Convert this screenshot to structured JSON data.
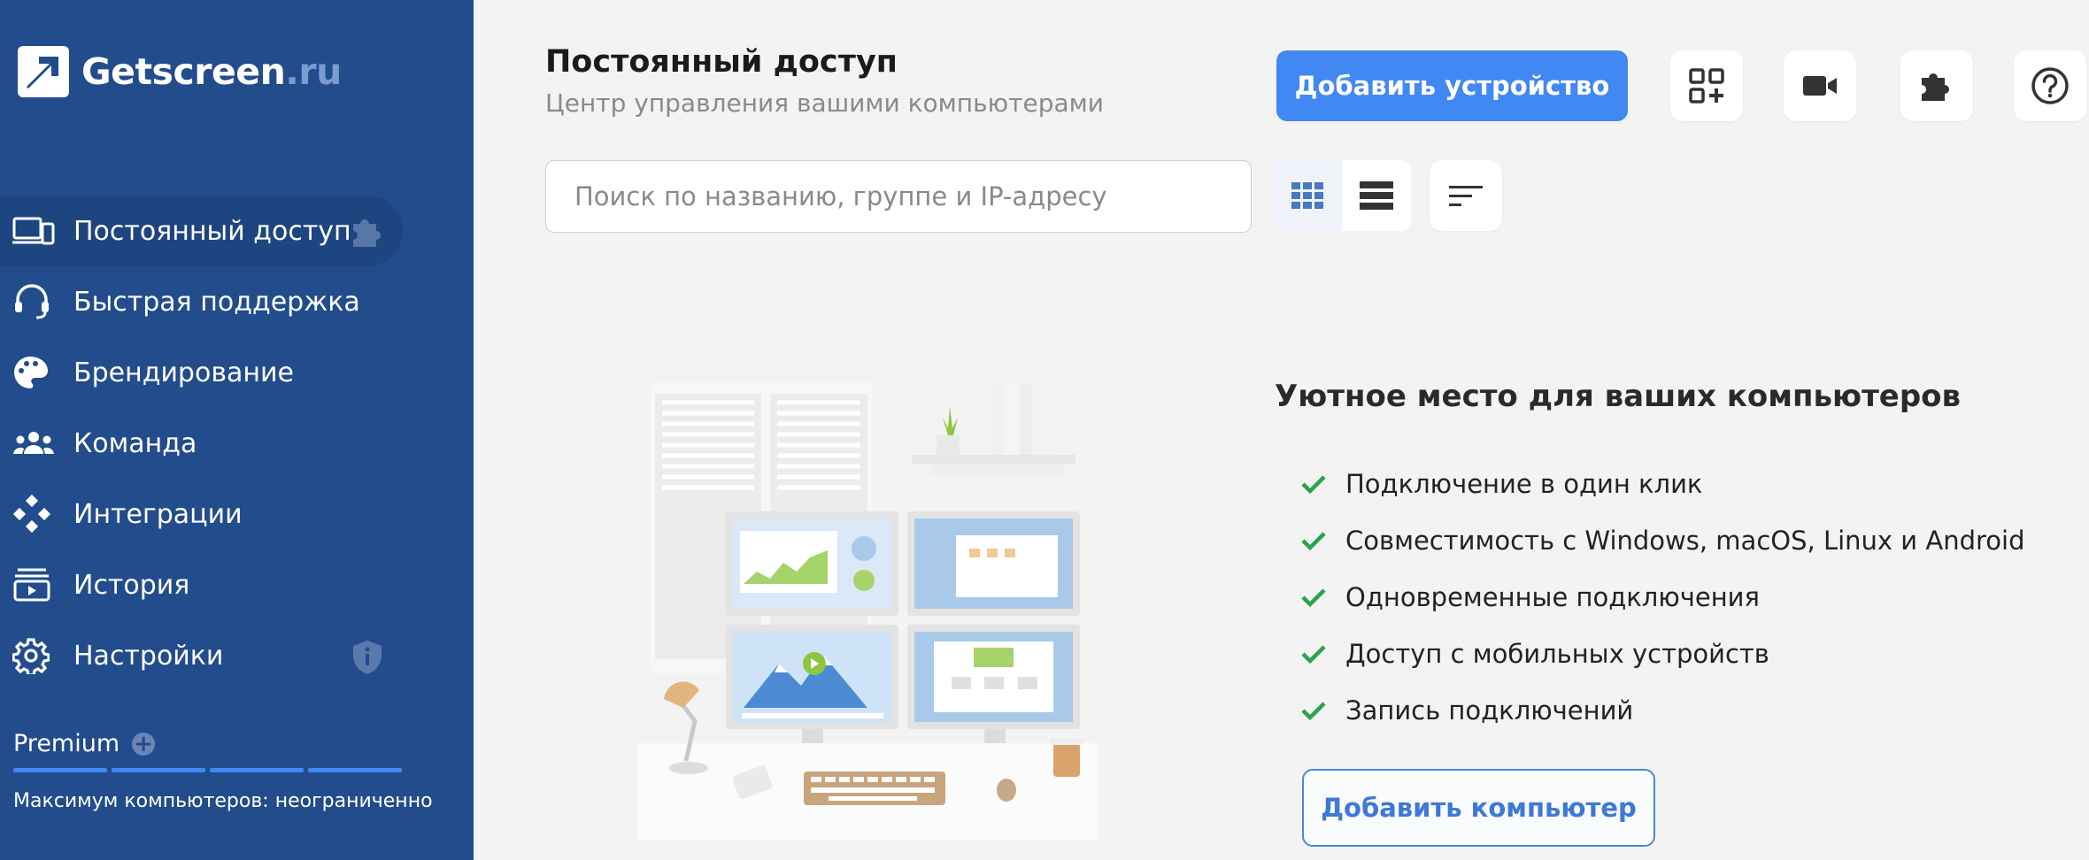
{
  "logo": {
    "name": "Getscreen",
    "tld": ".ru"
  },
  "sidebar": {
    "items": [
      {
        "label": "Постоянный доступ",
        "icon": "devices-icon",
        "active": true,
        "badge": "puzzle-icon"
      },
      {
        "label": "Быстрая поддержка",
        "icon": "headset-icon"
      },
      {
        "label": "Брендирование",
        "icon": "palette-icon"
      },
      {
        "label": "Команда",
        "icon": "team-icon"
      },
      {
        "label": "Интеграции",
        "icon": "integrations-icon"
      },
      {
        "label": "История",
        "icon": "history-icon"
      },
      {
        "label": "Настройки",
        "icon": "gear-icon",
        "badge": "shield-icon"
      }
    ],
    "plan": {
      "label": "Premium",
      "plus_icon": "plus-circle-icon",
      "segments": 4
    },
    "limit_text": "Максимум компьютеров: неограниченно"
  },
  "header": {
    "title": "Постоянный доступ",
    "subtitle": "Центр управления вашими компьютерами",
    "add_device_label": "Добавить устройство",
    "icon_buttons": [
      "qr-add-icon",
      "video-camera-icon",
      "puzzle-icon",
      "help-icon"
    ]
  },
  "toolbar": {
    "search_placeholder": "Поиск по названию, группе и IP-адресу",
    "search_value": "",
    "view_modes": [
      {
        "name": "grid-view-icon",
        "active": true
      },
      {
        "name": "list-view-icon",
        "active": false
      }
    ],
    "sort_icon": "sort-icon"
  },
  "empty_state": {
    "title": "Уютное место для ваших компьютеров",
    "features": [
      "Подключение в один клик",
      "Совместимость с Windows, macOS, Linux и Android",
      "Одновременные подключения",
      "Доступ с мобильных устройств",
      "Запись подключений"
    ],
    "add_computer_label": "Добавить компьютер"
  },
  "colors": {
    "sidebar_bg": "#224c8c",
    "accent": "#4288f3",
    "check": "#2aa44a",
    "background": "#f3f3f3"
  }
}
